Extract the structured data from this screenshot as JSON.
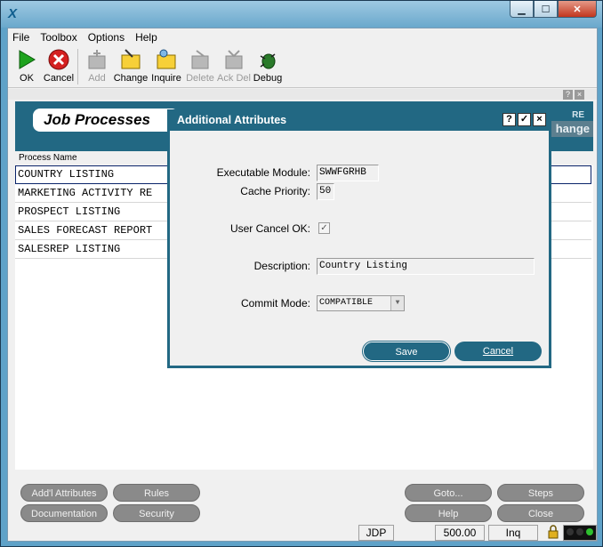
{
  "window": {
    "app_icon": "X",
    "buttons": [
      "minimize-icon",
      "maximize-icon",
      "close-icon"
    ]
  },
  "menu": [
    "File",
    "Toolbox",
    "Options",
    "Help"
  ],
  "toolbar": [
    {
      "label": "OK",
      "icon": "ok-arrow-icon",
      "enabled": true
    },
    {
      "label": "Cancel",
      "icon": "cancel-icon",
      "enabled": true
    },
    {
      "label": "Add",
      "icon": "add-icon",
      "enabled": false
    },
    {
      "label": "Change",
      "icon": "change-icon",
      "enabled": true
    },
    {
      "label": "Inquire",
      "icon": "inquire-icon",
      "enabled": true
    },
    {
      "label": "Delete",
      "icon": "delete-icon",
      "enabled": false
    },
    {
      "label": "Ack Del",
      "icon": "ack-delete-icon",
      "enabled": false
    },
    {
      "label": "Debug",
      "icon": "debug-icon",
      "enabled": true
    }
  ],
  "inner_buttons": [
    "?",
    "×"
  ],
  "panel": {
    "title": "Job Processes",
    "header_right": "hange",
    "column_header": "Process Name",
    "rows": [
      "COUNTRY LISTING",
      "MARKETING ACTIVITY RE",
      "PROSPECT LISTING",
      "SALES FORECAST REPORT",
      "SALESREP LISTING"
    ],
    "buttons": {
      "addl_attributes": "Add'l Attributes",
      "rules": "Rules",
      "documentation": "Documentation",
      "security": "Security",
      "goto": "Goto...",
      "steps": "Steps",
      "help": "Help",
      "close": "Close"
    }
  },
  "status": {
    "env": "JDP",
    "version": "500.00",
    "mode": "Inq"
  },
  "dialog": {
    "title": "Additional Attributes",
    "title_buttons": [
      "?",
      "✓",
      "×"
    ],
    "executable_module_label": "Executable Module:",
    "executable_module": "SWWFGRHB",
    "cache_priority_label": "Cache Priority:",
    "cache_priority": "50",
    "user_cancel_label": "User Cancel OK:",
    "user_cancel_checked": true,
    "description_label": "Description:",
    "description": "Country Listing",
    "commit_mode_label": "Commit Mode:",
    "commit_mode": "COMPATIBLE",
    "save": "Save",
    "cancel": "Cancel"
  }
}
